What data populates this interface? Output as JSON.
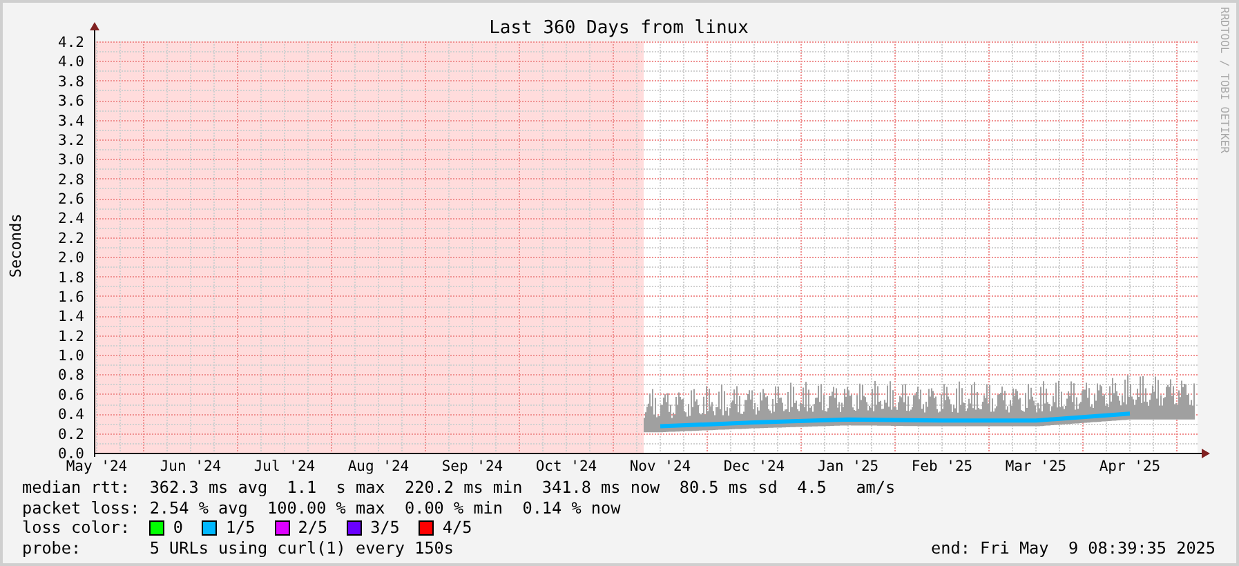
{
  "chart": {
    "chart_data": {
      "type": "line",
      "title": "Last 360 Days from linux",
      "ylabel": "Seconds",
      "categories": [
        "May '24",
        "Jun '24",
        "Jul '24",
        "Aug '24",
        "Sep '24",
        "Oct '24",
        "Nov '24",
        "Dec '24",
        "Jan '25",
        "Feb '25",
        "Mar '25",
        "Apr '25"
      ],
      "grid": true,
      "series": [
        {
          "color": "#00b4ff",
          "values": [
            null,
            null,
            null,
            null,
            null,
            null,
            0.27,
            0.31,
            0.34,
            0.33,
            0.33,
            0.4
          ]
        }
      ],
      "ylim": [
        0,
        4.2
      ],
      "yticks": [
        {
          "value": 0,
          "label": "0.0"
        },
        {
          "value": 0.2,
          "label": "0.2"
        },
        {
          "value": 0.4,
          "label": "0.4"
        },
        {
          "value": 0.6,
          "label": "0.6"
        },
        {
          "value": 0.8,
          "label": "0.8"
        },
        {
          "value": 1,
          "label": "1.0"
        },
        {
          "value": 1.2,
          "label": "1.2"
        },
        {
          "value": 1.4,
          "label": "1.4"
        },
        {
          "value": 1.6,
          "label": "1.6"
        },
        {
          "value": 1.8,
          "label": "1.8"
        },
        {
          "value": 2,
          "label": "2.0"
        },
        {
          "value": 2.2,
          "label": "2.2"
        },
        {
          "value": 2.4,
          "label": "2.4"
        },
        {
          "value": 2.6,
          "label": "2.6"
        },
        {
          "value": 2.8,
          "label": "2.8"
        },
        {
          "value": 3,
          "label": "3.0"
        },
        {
          "value": 3.2,
          "label": "3.2"
        },
        {
          "value": 3.4,
          "label": "3.4"
        },
        {
          "value": 3.6,
          "label": "3.6"
        },
        {
          "value": 3.8,
          "label": "3.8"
        },
        {
          "value": 4,
          "label": "4.0"
        },
        {
          "value": 4.2,
          "label": "4.2"
        }
      ]
    },
    "credit": "RRDTOOL / TOBI OETIKER"
  },
  "legend": {
    "lines": [
      {
        "label": "median rtt:",
        "text": "362.3 ms avg  1.1  s max  220.2 ms min  341.8 ms now  80.5 ms sd  4.5   am/s"
      },
      {
        "label": "packet loss:",
        "text": "2.54 % avg  100.00 % max  0.00 % min  0.14 % now"
      }
    ],
    "loss_color_label": "loss color:",
    "loss_colors": [
      {
        "label": "0",
        "color": "#00ff00"
      },
      {
        "label": "1/5",
        "color": "#00b8ff"
      },
      {
        "label": "2/5",
        "color": "#dd00ff"
      },
      {
        "label": "3/5",
        "color": "#6a00ff"
      },
      {
        "label": "4/5",
        "color": "#ff0000"
      }
    ],
    "probe_label": "probe:",
    "probe": "5 URLs using curl(1) every 150s",
    "end": "end: Fri May  9 08:39:35 2025"
  }
}
